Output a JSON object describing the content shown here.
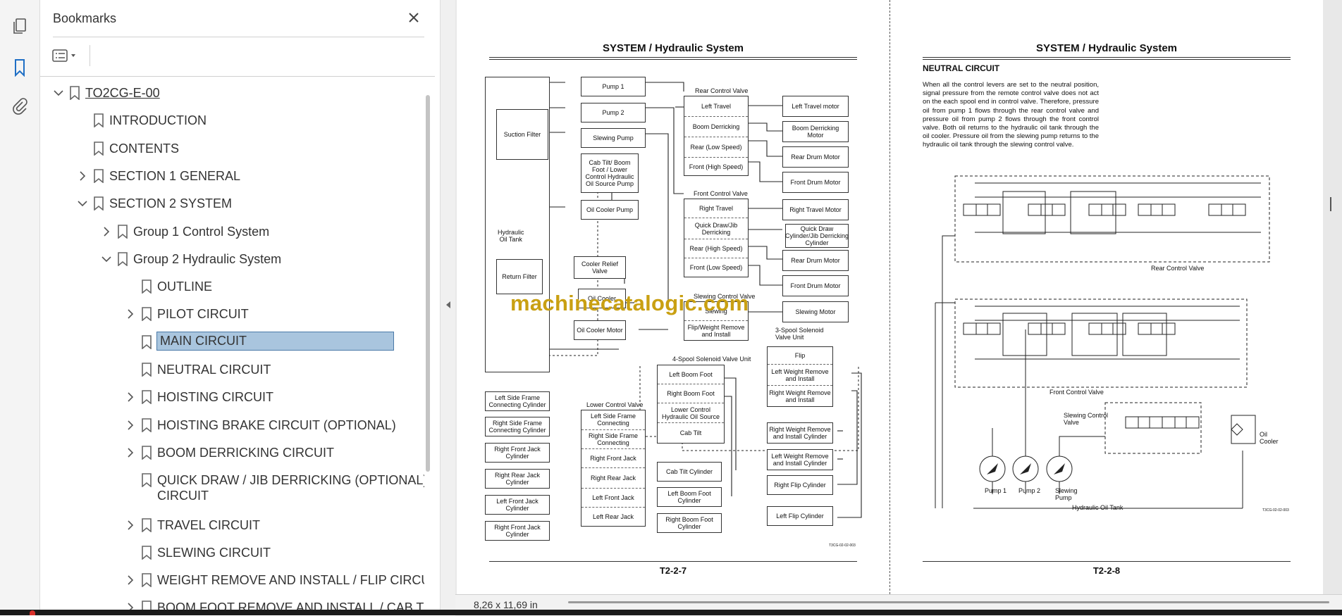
{
  "rail": {
    "icons": [
      "pages-icon",
      "bookmark-icon",
      "attachment-icon"
    ]
  },
  "bookmarks_panel": {
    "title": "Bookmarks",
    "close_icon": "close-icon",
    "options_icon": "list-options-icon",
    "selected_index": 10,
    "items": [
      {
        "label": "TO2CG-E-00",
        "level": 0,
        "expander": "expanded",
        "underline": true
      },
      {
        "label": "INTRODUCTION",
        "level": 1,
        "expander": "none"
      },
      {
        "label": "CONTENTS",
        "level": 1,
        "expander": "none"
      },
      {
        "label": "SECTION 1 GENERAL",
        "level": 1,
        "expander": "collapsed"
      },
      {
        "label": "SECTION 2 SYSTEM",
        "level": 1,
        "expander": "expanded"
      },
      {
        "label": "Group 1 Control System",
        "level": 2,
        "expander": "collapsed"
      },
      {
        "label": "Group 2 Hydraulic System",
        "level": 2,
        "expander": "expanded"
      },
      {
        "label": "OUTLINE",
        "level": 3,
        "expander": "none"
      },
      {
        "label": "PILOT CIRCUIT",
        "level": 3,
        "expander": "collapsed"
      },
      {
        "label": "MAIN CIRCUIT",
        "level": 3,
        "expander": "none"
      },
      {
        "label": "NEUTRAL CIRCUIT",
        "level": 3,
        "expander": "none"
      },
      {
        "label": "HOISTING CIRCUIT",
        "level": 3,
        "expander": "collapsed"
      },
      {
        "label": "HOISTING BRAKE CIRCUIT (OPTIONAL)",
        "level": 3,
        "expander": "collapsed"
      },
      {
        "label": "BOOM DERRICKING CIRCUIT",
        "level": 3,
        "expander": "collapsed"
      },
      {
        "label": "QUICK DRAW / JIB DERRICKING (OPTIONAL)",
        "level": 3,
        "expander": "none",
        "label2": "CIRCUIT"
      },
      {
        "label": "TRAVEL CIRCUIT",
        "level": 3,
        "expander": "collapsed"
      },
      {
        "label": "SLEWING CIRCUIT",
        "level": 3,
        "expander": "none"
      },
      {
        "label": "WEIGHT REMOVE AND INSTALL / FLIP CIRCUIT",
        "level": 3,
        "expander": "collapsed"
      },
      {
        "label": "BOOM FOOT REMOVE AND INSTALL / CAB TILT",
        "level": 3,
        "expander": "collapsed"
      }
    ]
  },
  "document": {
    "watermark": "machinecatalogic.com",
    "page_left": {
      "header": "SYSTEM / Hydraulic System",
      "footer": "T2-2-7",
      "figure_code": "T3CG-02-02-003",
      "boxes": {
        "suction_filter": "Suction Filter",
        "hydraulic_oil_tank": "Hydraulic\nOil Tank",
        "return_filter": "Return Filter",
        "pump1": "Pump 1",
        "pump2": "Pump 2",
        "slewing_pump": "Slewing Pump",
        "cab_tilt_source": "Cab Tilt/ Boom\nFoot / Lower\nControl Hydraulic\nOil Source Pump",
        "oil_cooler_pump": "Oil Cooler Pump",
        "cooler_relief": "Cooler Relief\nValve",
        "oil_cooler": "Oil Cooler",
        "oil_cooler_motor": "Oil Cooler Motor",
        "rear_control_valve": "Rear Control Valve",
        "left_travel": "Left Travel",
        "boom_derricking": "Boom Derricking",
        "rear_low": "Rear (Low Speed)",
        "front_high": "Front (High Speed)",
        "left_travel_motor": "Left Travel motor",
        "boom_derricking_motor": "Boom Derricking Motor",
        "rear_drum_motor": "Rear Drum Motor",
        "front_drum_motor": "Front Drum Motor",
        "front_control_valve": "Front Control Valve",
        "right_travel": "Right Travel",
        "quick_draw": "Quick Draw/Jib\nDerricking",
        "rear_high": "Rear (High Speed)",
        "front_low": "Front (Low Speed)",
        "right_travel_motor": "Right Travel Motor",
        "quick_draw_cyl": "Quick Draw\nCylinder/Jib Derricking\nCylinder",
        "rear_drum_motor2": "Rear Drum Motor",
        "front_drum_motor2": "Front Drum Motor",
        "slewing_control_valve": "Slewing Control Valve",
        "slewing": "Slewing",
        "flip_weight": "Flip/Weight Remove\nand Install",
        "slewing_motor": "Slewing Motor",
        "three_spool": "3-Spool Solenoid\nValve Unit",
        "four_spool": "4-Spool Solenoid Valve Unit",
        "flip": "Flip",
        "left_weight_ri": "Left Weight Remove\nand Install",
        "right_weight_ri": "Right Weight Remove\nand Install",
        "left_boom_foot": "Left Boom Foot",
        "right_boom_foot": "Right Boom Foot",
        "lower_control_source": "Lower Control\nHydraulic Oil Source",
        "cab_tilt": "Cab Tilt",
        "lower_control_valve": "Lower Control Valve",
        "left_side_frame": "Left Side Frame\nConnecting",
        "right_side_frame": "Right Side Frame\nConnecting",
        "right_front_jack": "Right Front Jack",
        "right_rear_jack": "Right Rear Jack",
        "left_front_jack": "Left Front Jack",
        "left_rear_jack": "Left Rear Jack",
        "left_side_frame_cyl": "Left Side Frame\nConnecting Cylinder",
        "right_side_frame_cyl": "Right Side Frame\nConnecting Cylinder",
        "right_front_jack_cyl": "Right Front Jack\nCylinder",
        "right_rear_jack_cyl": "Right Rear Jack\nCylinder",
        "left_front_jack_cyl": "Left Front Jack\nCylinder",
        "right_front_jack_cyl2": "Right Front Jack\nCylinder",
        "cab_tilt_cyl": "Cab Tilt Cylinder",
        "left_boom_foot_cyl": "Left Boom Foot\nCylinder",
        "right_boom_foot_cyl": "Right Boom Foot\nCylinder",
        "right_weight_cyl": "Right Weight Remove\nand Install Cylinder",
        "left_weight_cyl": "Left Weight Remove\nand Install Cylinder",
        "right_flip_cyl": "Right Flip Cylinder",
        "left_flip_cyl": "Left Flip Cylinder"
      }
    },
    "page_right": {
      "header": "SYSTEM / Hydraulic System",
      "footer": "T2-2-8",
      "figure_code": "T3CG-02-02-003",
      "section_title": "NEUTRAL CIRCUIT",
      "body": "When all the control levers are set to the neutral position, signal pressure from the remote control valve does not act on the each spool end in control valve. Therefore, pressure oil from pump 1 flows through the rear control valve and pressure oil from pump 2 flows through the front control valve. Both oil returns to the hydraulic oil tank through the oil cooler. Pressure oil from the slewing pump returns to the hydraulic oil tank through the slewing control valve.",
      "labels": {
        "rear_control_valve": "Rear Control Valve",
        "front_control_valve": "Front Control Valve",
        "slewing_control_valve": "Slewing Control\nValve",
        "oil_cooler": "Oil\nCooler",
        "pump1": "Pump 1",
        "pump2": "Pump 2",
        "slewing_pump": "Slewing\nPump",
        "hydraulic_oil_tank": "Hydraulic Oil Tank"
      }
    }
  },
  "status": {
    "page_size": "8,26 x 11,69 in"
  },
  "colors": {
    "selection_bg": "#a9c5de",
    "accent_icon": "#1f6fc5",
    "watermark": "#c9a012"
  }
}
